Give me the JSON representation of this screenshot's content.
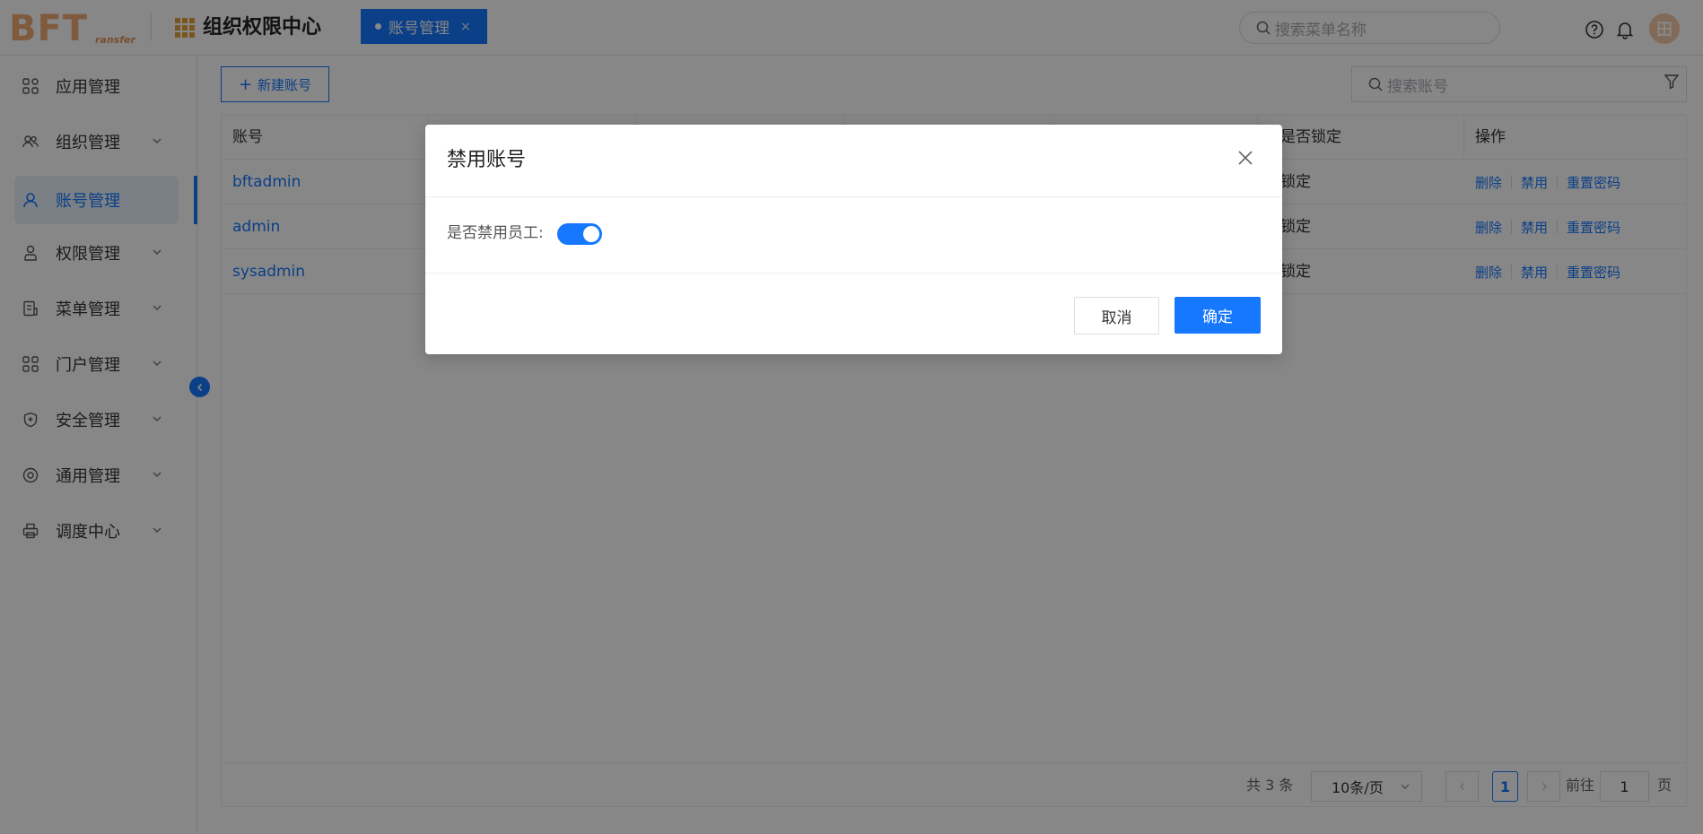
{
  "header": {
    "logo_main": "BFT",
    "logo_sub": "ransfer",
    "app_title": "组织权限中心",
    "tab_label": "账号管理",
    "tab_close": "×",
    "menu_search_placeholder": "搜索菜单名称",
    "avatar_text": "田"
  },
  "sidebar": {
    "items": [
      {
        "label": "应用管理",
        "icon": "apps-grid-icon"
      },
      {
        "label": "组织管理",
        "icon": "users-icon"
      },
      {
        "label": "账号管理",
        "icon": "user-icon"
      },
      {
        "label": "权限管理",
        "icon": "permission-icon"
      },
      {
        "label": "菜单管理",
        "icon": "menu-doc-icon"
      },
      {
        "label": "门户管理",
        "icon": "portal-grid-icon"
      },
      {
        "label": "安全管理",
        "icon": "shield-icon"
      },
      {
        "label": "通用管理",
        "icon": "settings-icon"
      },
      {
        "label": "调度中心",
        "icon": "printer-icon"
      }
    ],
    "active_index": 2
  },
  "toolbar": {
    "new_account_label": "新建账号",
    "account_search_placeholder": "搜索账号"
  },
  "table": {
    "headers": [
      "账号",
      "是否锁定",
      "操作"
    ],
    "rows": [
      {
        "account": "bftadmin",
        "locked": "锁定"
      },
      {
        "account": "admin",
        "locked": "锁定"
      },
      {
        "account": "sysadmin",
        "locked": "锁定"
      }
    ],
    "actions": [
      "删除",
      "禁用",
      "重置密码"
    ]
  },
  "pagination": {
    "total_text": "共 3 条",
    "page_size": "10条/页",
    "current_page": "1",
    "goto_label": "前往",
    "goto_value": "1",
    "page_suffix": "页"
  },
  "modal": {
    "title": "禁用账号",
    "field_label": "是否禁用员工:",
    "switch_on": true,
    "cancel_label": "取消",
    "ok_label": "确定"
  },
  "colors": {
    "primary": "#1677ff",
    "logo": "#f0aa73",
    "app_icon": "#e6a23c"
  }
}
